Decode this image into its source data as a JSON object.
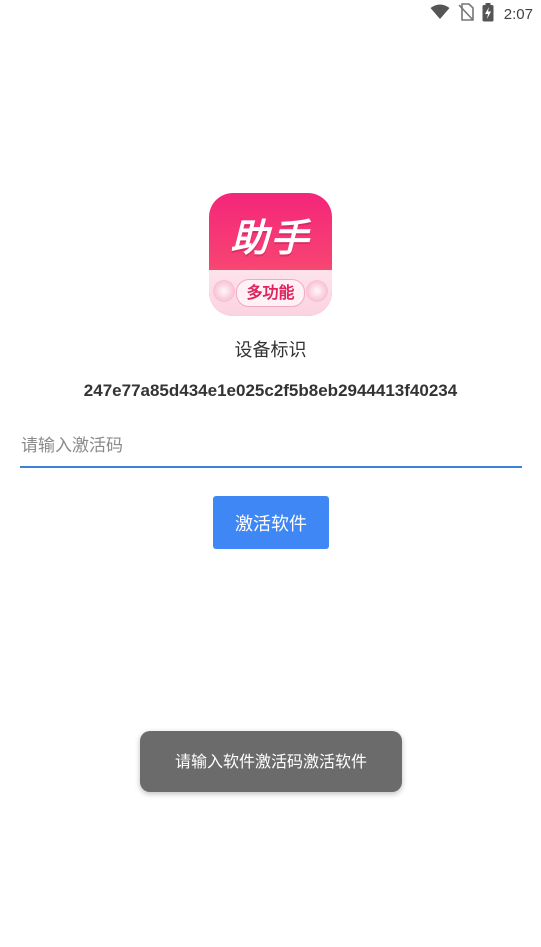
{
  "status_bar": {
    "time": "2:07",
    "wifi_icon": "wifi-icon",
    "signal_icon": "no-sim-icon",
    "battery_icon": "battery-charging-icon"
  },
  "logo": {
    "title": "助手",
    "subtitle": "多功能"
  },
  "device": {
    "label": "设备标识",
    "id": "247e77a85d434e1e025c2f5b8eb2944413f40234"
  },
  "activation": {
    "input_value": "",
    "input_placeholder": "请输入激活码",
    "button_label": "激活软件"
  },
  "toast": {
    "message": "请输入软件激活码激活软件"
  },
  "colors": {
    "accent": "#3f87f5",
    "input_underline": "#3b82d8",
    "toast_bg": "#6b6b6b",
    "logo_pink": "#f4267a"
  }
}
